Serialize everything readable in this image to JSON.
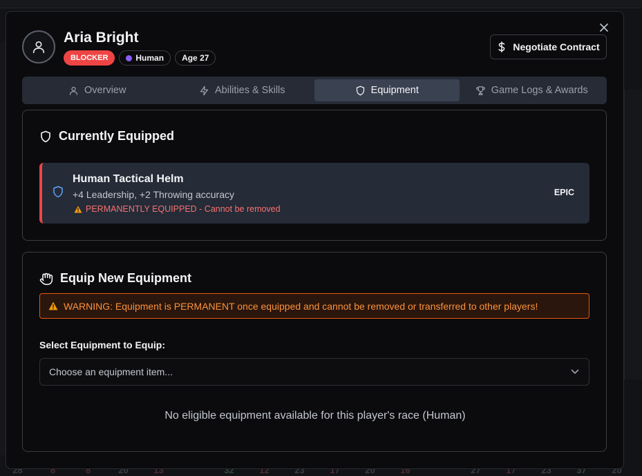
{
  "player": {
    "name": "Aria Bright",
    "position": "BLOCKER",
    "race": "Human",
    "age": "Age 27"
  },
  "header": {
    "negotiate_label": "Negotiate Contract"
  },
  "tabs": [
    {
      "label": "Overview",
      "icon": "user-icon",
      "active": false
    },
    {
      "label": "Abilities & Skills",
      "icon": "lightning-icon",
      "active": false
    },
    {
      "label": "Equipment",
      "icon": "shield-icon",
      "active": true
    },
    {
      "label": "Game Logs & Awards",
      "icon": "trophy-icon",
      "active": false
    }
  ],
  "equipped": {
    "title": "Currently Equipped",
    "item": {
      "name": "Human Tactical Helm",
      "stats": "+4 Leadership, +2 Throwing accuracy",
      "warning": "PERMANENTLY EQUIPPED - Cannot be removed",
      "rarity": "EPIC"
    }
  },
  "equip_new": {
    "title": "Equip New Equipment",
    "warning": "WARNING: Equipment is PERMANENT once equipped and cannot be removed or transferred to other players!",
    "select_label": "Select Equipment to Equip:",
    "select_placeholder": "Choose an equipment item...",
    "empty_message": "No eligible equipment available for this player's race (Human)"
  },
  "background": {
    "bottom_numbers": [
      "28",
      "8",
      "8",
      "20",
      "13",
      "",
      "32",
      "12",
      "23",
      "17",
      "20",
      "16",
      "",
      "27",
      "17",
      "23",
      "37",
      "20"
    ]
  },
  "colors": {
    "accent_red": "#ef4444",
    "warning_orange": "#fb923c",
    "rarity_border": "#ef4444",
    "active_tab": "#3a4150"
  }
}
